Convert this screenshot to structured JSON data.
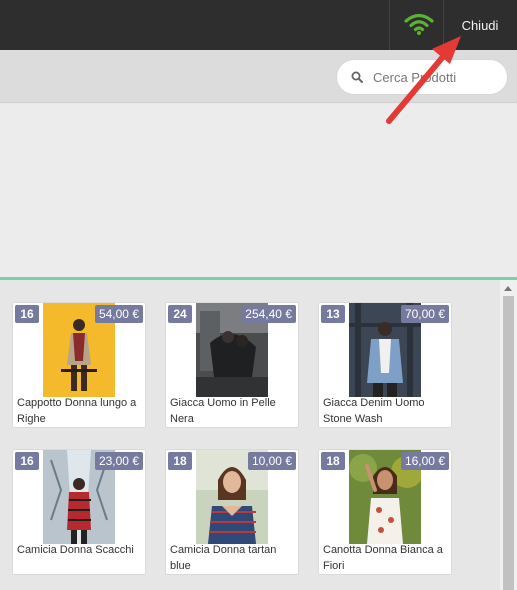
{
  "header": {
    "close_label": "Chiudi",
    "wifi_icon": "wifi-icon",
    "wifi_color": "#5bb234"
  },
  "search": {
    "placeholder": "Cerca Prodotti",
    "icon": "search-icon"
  },
  "colors": {
    "badge": "#757a9e",
    "accent_line": "#7bd0a6",
    "arrow": "#e53935"
  },
  "products": [
    {
      "qty": "16",
      "price": "54,00 €",
      "name": "Cappotto Donna lungo a Righe"
    },
    {
      "qty": "24",
      "price": "254,40 €",
      "name": "Giacca Uomo in Pelle Nera"
    },
    {
      "qty": "13",
      "price": "70,00 €",
      "name": "Giacca Denim Uomo Stone Wash"
    },
    {
      "qty": "16",
      "price": "23,00 €",
      "name": "Camicia Donna Scacchi"
    },
    {
      "qty": "18",
      "price": "10,00 €",
      "name": "Camicia Donna tartan blue"
    },
    {
      "qty": "18",
      "price": "16,00 €",
      "name": "Canotta Donna Bianca a Fiori"
    }
  ]
}
